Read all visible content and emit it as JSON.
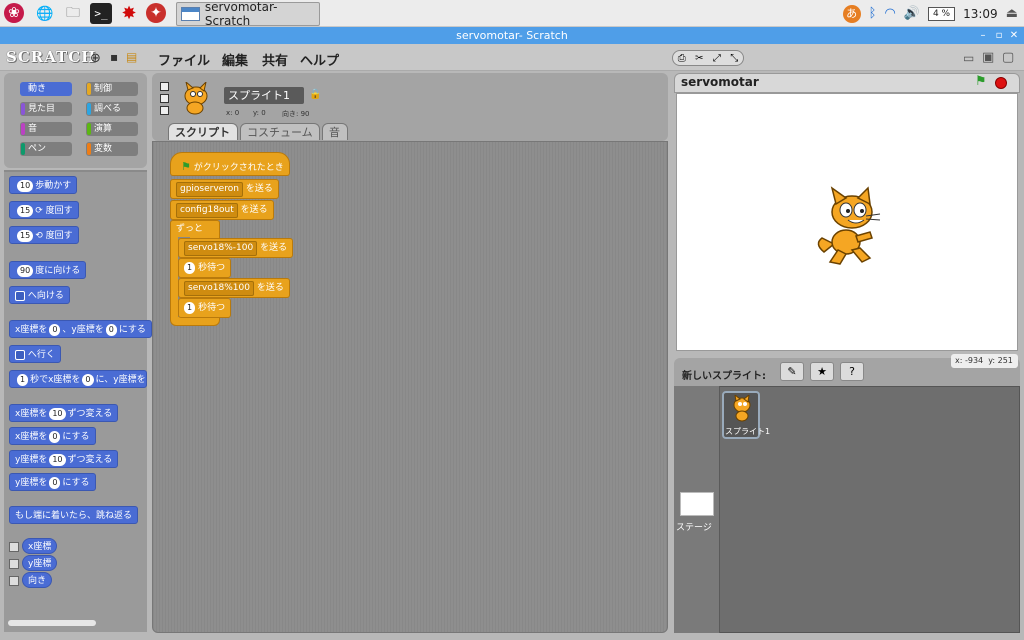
{
  "taskbar": {
    "window_title": "servomotar- Scratch",
    "battery": "4 %",
    "clock": "13:09",
    "ime": "あ"
  },
  "titlebar": {
    "title": "servomotar- Scratch"
  },
  "menu": {
    "logo": "SCRATCH",
    "items": [
      "ファイル",
      "編集",
      "共有",
      "ヘルプ"
    ]
  },
  "categories": [
    {
      "label": "動き",
      "color": "#4a6cd4"
    },
    {
      "label": "制御",
      "color": "#e6a822"
    },
    {
      "label": "見た目",
      "color": "#8a55d7"
    },
    {
      "label": "調べる",
      "color": "#2ca5e2"
    },
    {
      "label": "音",
      "color": "#bb42c3"
    },
    {
      "label": "演算",
      "color": "#5cb712"
    },
    {
      "label": "ペン",
      "color": "#0e9a6c"
    },
    {
      "label": "変数",
      "color": "#ee7d16"
    }
  ],
  "palette": {
    "move": {
      "n": "10",
      "t": "歩動かす"
    },
    "turn_r": {
      "n": "15",
      "t": "度回す"
    },
    "turn_l": {
      "n": "15",
      "t": "度回す"
    },
    "point_dir": {
      "n": "90",
      "t": "度に向ける"
    },
    "point_to": {
      "t": "へ向ける"
    },
    "goto_xy": {
      "a": "x座標を",
      "x": "0",
      "b": "、y座標を",
      "y": "0",
      "c": "にする"
    },
    "goto": {
      "t": "へ行く"
    },
    "glide": {
      "n": "1",
      "a": "秒でx座標を",
      "x": "0",
      "b": "に、y座標を"
    },
    "change_x": {
      "a": "x座標を",
      "n": "10",
      "b": "ずつ変える"
    },
    "set_x": {
      "a": "x座標を",
      "n": "0",
      "b": "にする"
    },
    "change_y": {
      "a": "y座標を",
      "n": "10",
      "b": "ずつ変える"
    },
    "set_y": {
      "a": "y座標を",
      "n": "0",
      "b": "にする"
    },
    "bounce": "もし端に着いたら、跳ね返る",
    "rep_x": "x座標",
    "rep_y": "y座標",
    "rep_dir": "向き"
  },
  "sprite": {
    "name": "スプライト1",
    "x_label": "x: 0",
    "y_label": "y: 0",
    "dir_label": "向き: 90"
  },
  "tabs": [
    "スクリプト",
    "コスチューム",
    "音"
  ],
  "script": {
    "hat": "がクリックされたとき",
    "broadcast1": "gpioserveron",
    "broadcast2": "config18out",
    "send": "を送る",
    "forever": "ずっと",
    "broadcast3": "servo18%-100",
    "wait1_n": "1",
    "wait": "秒待つ",
    "broadcast4": "servo18%100",
    "wait2_n": "1"
  },
  "stage": {
    "title": "servomotar",
    "coord_x": "x: -934",
    "coord_y": "y: 251"
  },
  "sprites_panel": {
    "new_sprite": "新しいスプライト:",
    "sprite_label": "スプライト1",
    "stage_label": "ステージ"
  }
}
